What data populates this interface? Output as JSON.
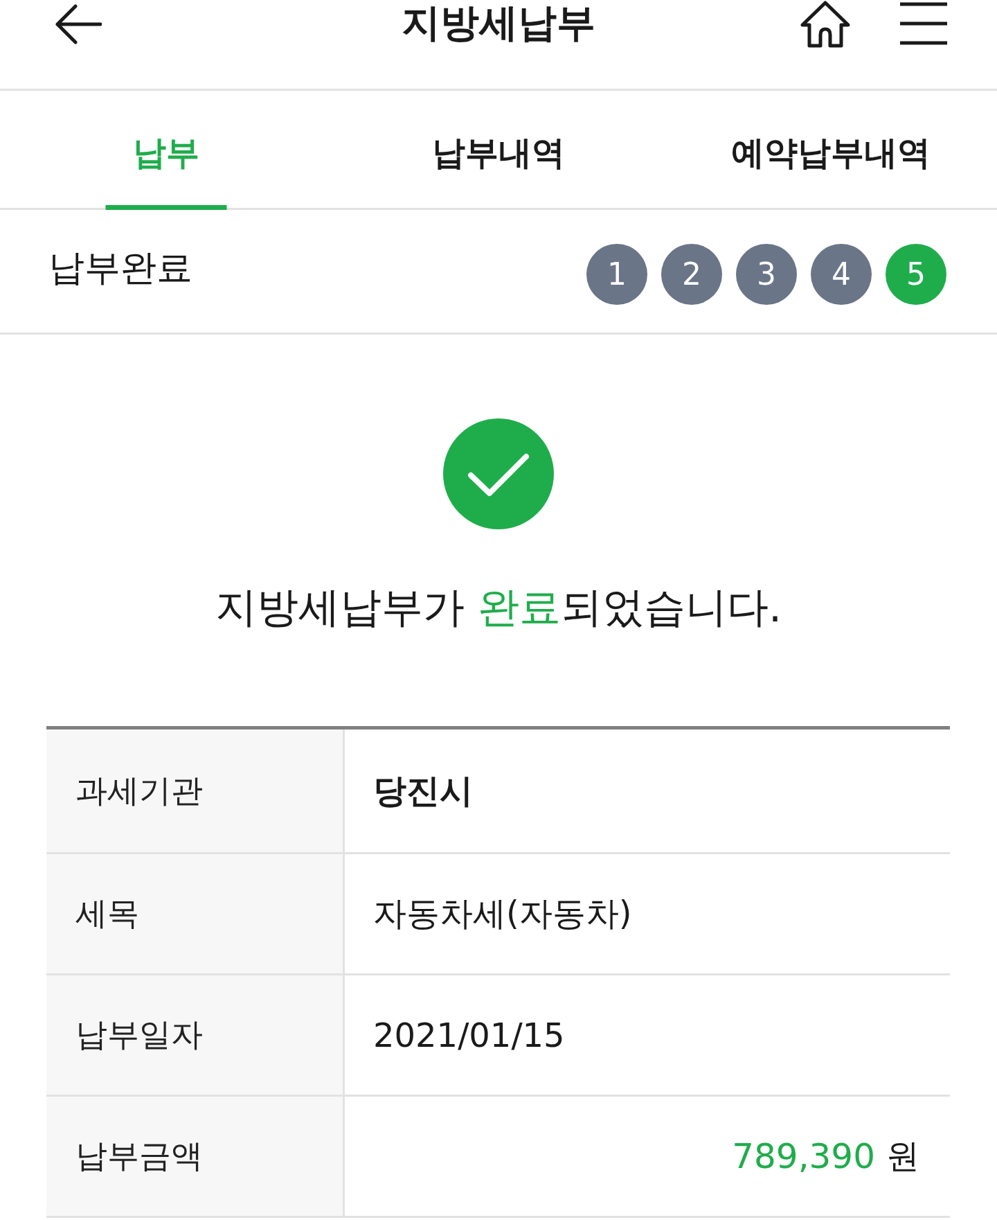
{
  "header": {
    "title": "지방세납부"
  },
  "tabs": [
    {
      "label": "납부",
      "selected": true
    },
    {
      "label": "납부내역",
      "selected": false
    },
    {
      "label": "예약납부내역",
      "selected": false
    }
  ],
  "step_bar": {
    "title": "납부완료",
    "steps": [
      {
        "label": "1",
        "selected": false
      },
      {
        "label": "2",
        "selected": false
      },
      {
        "label": "3",
        "selected": false
      },
      {
        "label": "4",
        "selected": false
      },
      {
        "label": "5",
        "selected": true
      }
    ]
  },
  "result": {
    "message": [
      {
        "text": "지방세납부가 ",
        "highlight": false
      },
      {
        "text": "완료",
        "highlight": true
      },
      {
        "text": "되었습니다.",
        "highlight": false
      }
    ]
  },
  "details": [
    {
      "kind": "bold",
      "label": "과세기관",
      "value": "당진시"
    },
    {
      "kind": "plain",
      "label": "세목",
      "value": "자동차세(자동차)"
    },
    {
      "kind": "plain",
      "label": "납부일자",
      "value": "2021/01/15"
    },
    {
      "kind": "amount",
      "label": "납부금액",
      "value": "789,390",
      "unit": "원"
    }
  ]
}
